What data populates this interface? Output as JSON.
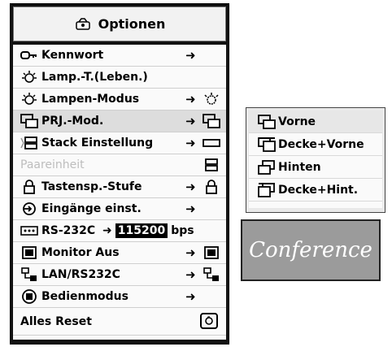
{
  "menu": {
    "title": "Optionen",
    "items": [
      {
        "label": "Kennwort",
        "icon": "key-icon",
        "arrow": "➜"
      },
      {
        "label": "Lamp.-T.(Leben.)",
        "icon": "lamp-icon"
      },
      {
        "label": "Lampen-Modus",
        "icon": "lamp-icon",
        "arrow": "➜",
        "sub_icon": "lamp-mode-icon"
      },
      {
        "label": "PRJ.-Mod.",
        "icon": "projector-mode-icon",
        "arrow": "➜",
        "sub_icon": "projector-mode-icon",
        "selected": true
      },
      {
        "label": "Stack Einstellung",
        "icon": "stack-icon",
        "arrow": "➜",
        "sub_icon": "stack-icon"
      },
      {
        "label": "Paareinheit",
        "icon": "",
        "disabled": true,
        "sub_icon": "pair-icon"
      },
      {
        "label": "Tastensp.-Stufe",
        "icon": "lock-icon",
        "arrow": "➜",
        "sub_icon": "lock-icon"
      },
      {
        "label": "Eingänge einst.",
        "icon": "input-icon",
        "arrow": "➜"
      },
      {
        "label": "RS-232C",
        "icon": "rs232-icon",
        "arrow": "➜",
        "baud": "115200",
        "unit": "bps"
      },
      {
        "label": "Monitor Aus",
        "icon": "monitor-icon",
        "arrow": "➜",
        "sub_icon": "monitor-icon"
      },
      {
        "label": "LAN/RS232C",
        "icon": "lan-icon",
        "arrow": "➜",
        "sub_icon": "lan-icon"
      },
      {
        "label": "Bedienmodus",
        "icon": "operation-mode-icon",
        "arrow": "➜"
      },
      {
        "label": "Alles Reset",
        "icon": "",
        "reset": true
      }
    ]
  },
  "submenu": {
    "items": [
      {
        "label": "Vorne",
        "icon": "front-icon",
        "selected": true
      },
      {
        "label": "Decke+Vorne",
        "icon": "ceiling-front-icon"
      },
      {
        "label": "Hinten",
        "icon": "rear-icon"
      },
      {
        "label": "Decke+Hint.",
        "icon": "ceiling-rear-icon"
      }
    ]
  },
  "conference": {
    "text": "Conference"
  }
}
